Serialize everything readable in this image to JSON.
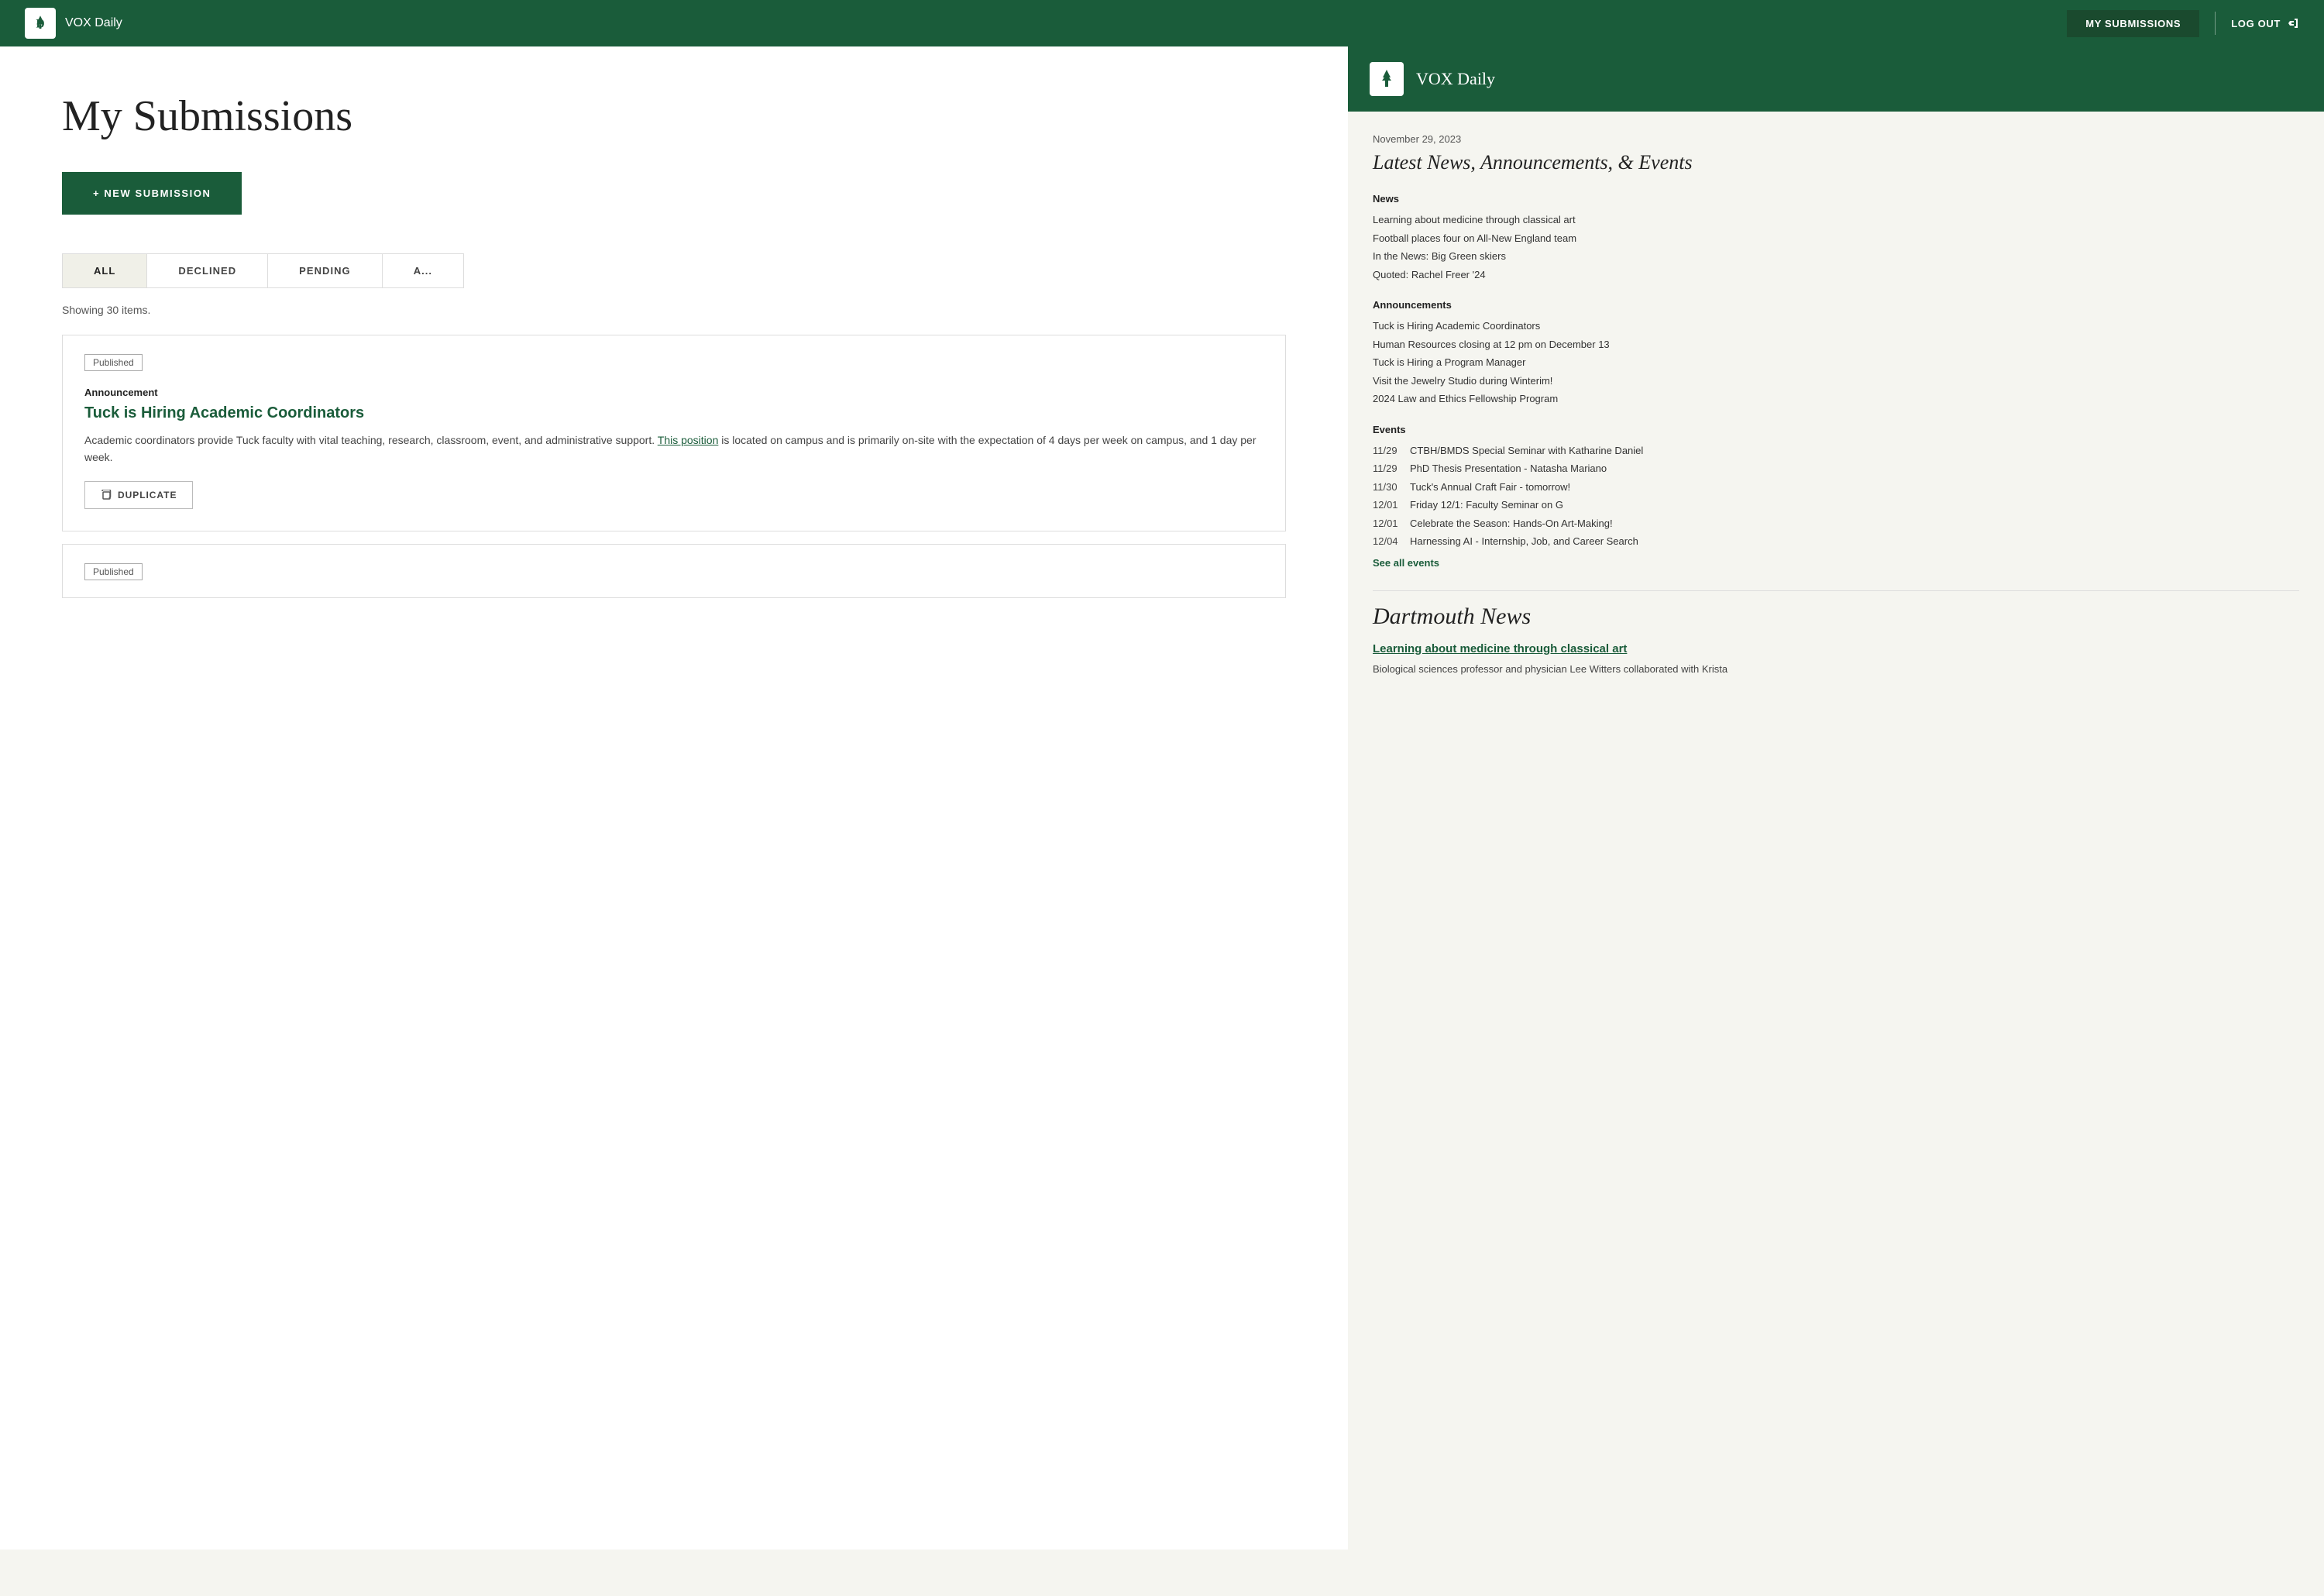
{
  "nav": {
    "logo_alt": "Dartmouth D logo",
    "site_title": "VOX Daily",
    "submissions_btn": "MY SUBMISSIONS",
    "logout_btn": "LOG OUT"
  },
  "left": {
    "page_title": "My Submissions",
    "new_submission_btn": "+ NEW SUBMISSION",
    "tabs": [
      {
        "label": "ALL",
        "active": true
      },
      {
        "label": "DECLINED",
        "active": false
      },
      {
        "label": "PENDING",
        "active": false
      },
      {
        "label": "A...",
        "active": false,
        "partial": true
      }
    ],
    "showing_items": "Showing 30 items.",
    "cards": [
      {
        "badge": "Published",
        "type": "Announcement",
        "title": "Tuck is Hiring Academic Coordinators",
        "body_text": "Academic coordinators provide Tuck faculty with vital teaching, research, classroom, event, and administrative support. ",
        "body_link_text": "This position",
        "body_after": " is located on campus and is primarily on-site with the expectation of 4 days per week on campus, and 1 day per week.",
        "duplicate_btn": "DUPLICATE"
      },
      {
        "badge": "Published",
        "type": "",
        "title": "",
        "body_text": "",
        "body_link_text": "",
        "body_after": "",
        "duplicate_btn": ""
      }
    ]
  },
  "right": {
    "header_title": "VOX Daily",
    "date": "November 29, 2023",
    "newsletter_heading": "Latest News, Announcements, & Events",
    "sections": {
      "news": {
        "heading": "News",
        "items": [
          "Learning about medicine through classical art",
          "Football places four on All-New England team",
          "In the News: Big Green skiers",
          "Quoted: Rachel Freer '24"
        ]
      },
      "announcements": {
        "heading": "Announcements",
        "items": [
          "Tuck is Hiring Academic Coordinators",
          "Human Resources closing at 12 pm on December 13",
          "Tuck is Hiring a Program Manager",
          "Visit the Jewelry Studio during Winterim!",
          "2024 Law and Ethics Fellowship Program"
        ]
      },
      "events": {
        "heading": "Events",
        "items": [
          {
            "date": "11/29",
            "text": "CTBH/BMDS Special Seminar with Katharine Daniel"
          },
          {
            "date": "11/29",
            "text": "PhD Thesis Presentation - Natasha Mariano"
          },
          {
            "date": "11/30",
            "text": "Tuck's Annual Craft Fair - tomorrow!"
          },
          {
            "date": "12/01",
            "text": "Friday 12/1: Faculty Seminar on G"
          },
          {
            "date": "12/01",
            "text": "Celebrate the Season: Hands-On Art-Making!"
          },
          {
            "date": "12/04",
            "text": "Harnessing AI - Internship, Job, and Career Search"
          }
        ],
        "see_all": "See all events"
      }
    },
    "dartmouth_news": {
      "heading": "Dartmouth News",
      "articles": [
        {
          "title": "Learning about medicine through classical art",
          "body": "Biological sciences professor and physician Lee Witters collaborated with Krista"
        }
      ]
    }
  }
}
